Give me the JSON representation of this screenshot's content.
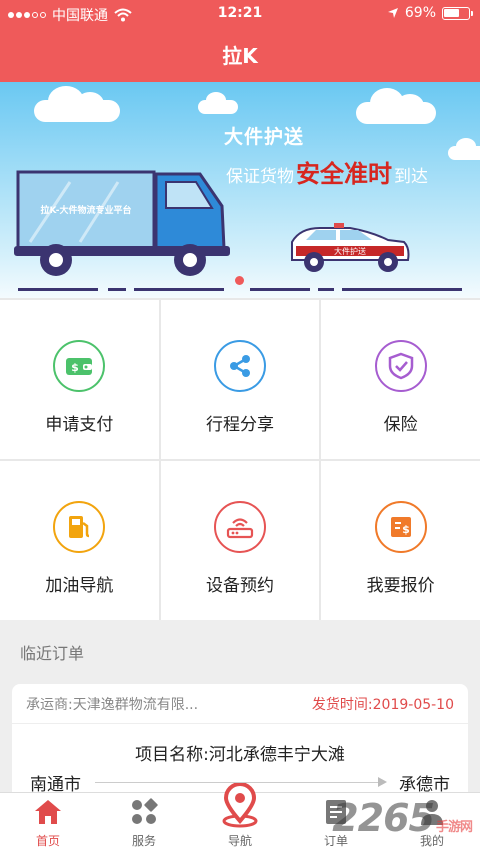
{
  "status_bar": {
    "carrier": "中国联通",
    "time": "12:21",
    "battery_text": "69%",
    "battery_level": 0.69
  },
  "header": {
    "title": "拉K"
  },
  "banner": {
    "headline": "大件护送",
    "subline_pre": "保证货物",
    "subline_emph": "安全准时",
    "subline_post": "到达",
    "truck_text": "拉K-大件物流专业平台",
    "car_text": "大件护送"
  },
  "services": [
    {
      "label": "申请支付",
      "icon": "wallet-icon",
      "color": "#4cc26b"
    },
    {
      "label": "行程分享",
      "icon": "share-icon",
      "color": "#3a9be4"
    },
    {
      "label": "保险",
      "icon": "shield-icon",
      "color": "#a65dd0"
    },
    {
      "label": "加油导航",
      "icon": "fuel-icon",
      "color": "#f2a40e"
    },
    {
      "label": "设备预约",
      "icon": "router-icon",
      "color": "#e65454"
    },
    {
      "label": "我要报价",
      "icon": "quote-icon",
      "color": "#f07a2a"
    }
  ],
  "recent": {
    "title": "临近订单",
    "order": {
      "carrier": "承运商:天津逸群物流有限...",
      "ship_time": "发货时间:2019-05-10",
      "project": "项目名称:河北承德丰宁大滩",
      "from": "南通市",
      "to": "承德市"
    }
  },
  "tabbar": {
    "items": [
      {
        "label": "首页",
        "icon": "home-icon"
      },
      {
        "label": "服务",
        "icon": "services-icon"
      },
      {
        "label": "导航",
        "icon": "location-pin-icon"
      },
      {
        "label": "订单",
        "icon": "orders-icon"
      },
      {
        "label": "我的",
        "icon": "profile-icon"
      }
    ],
    "active": "首页"
  },
  "watermark": {
    "main": "2265",
    "sub": "手游网"
  }
}
